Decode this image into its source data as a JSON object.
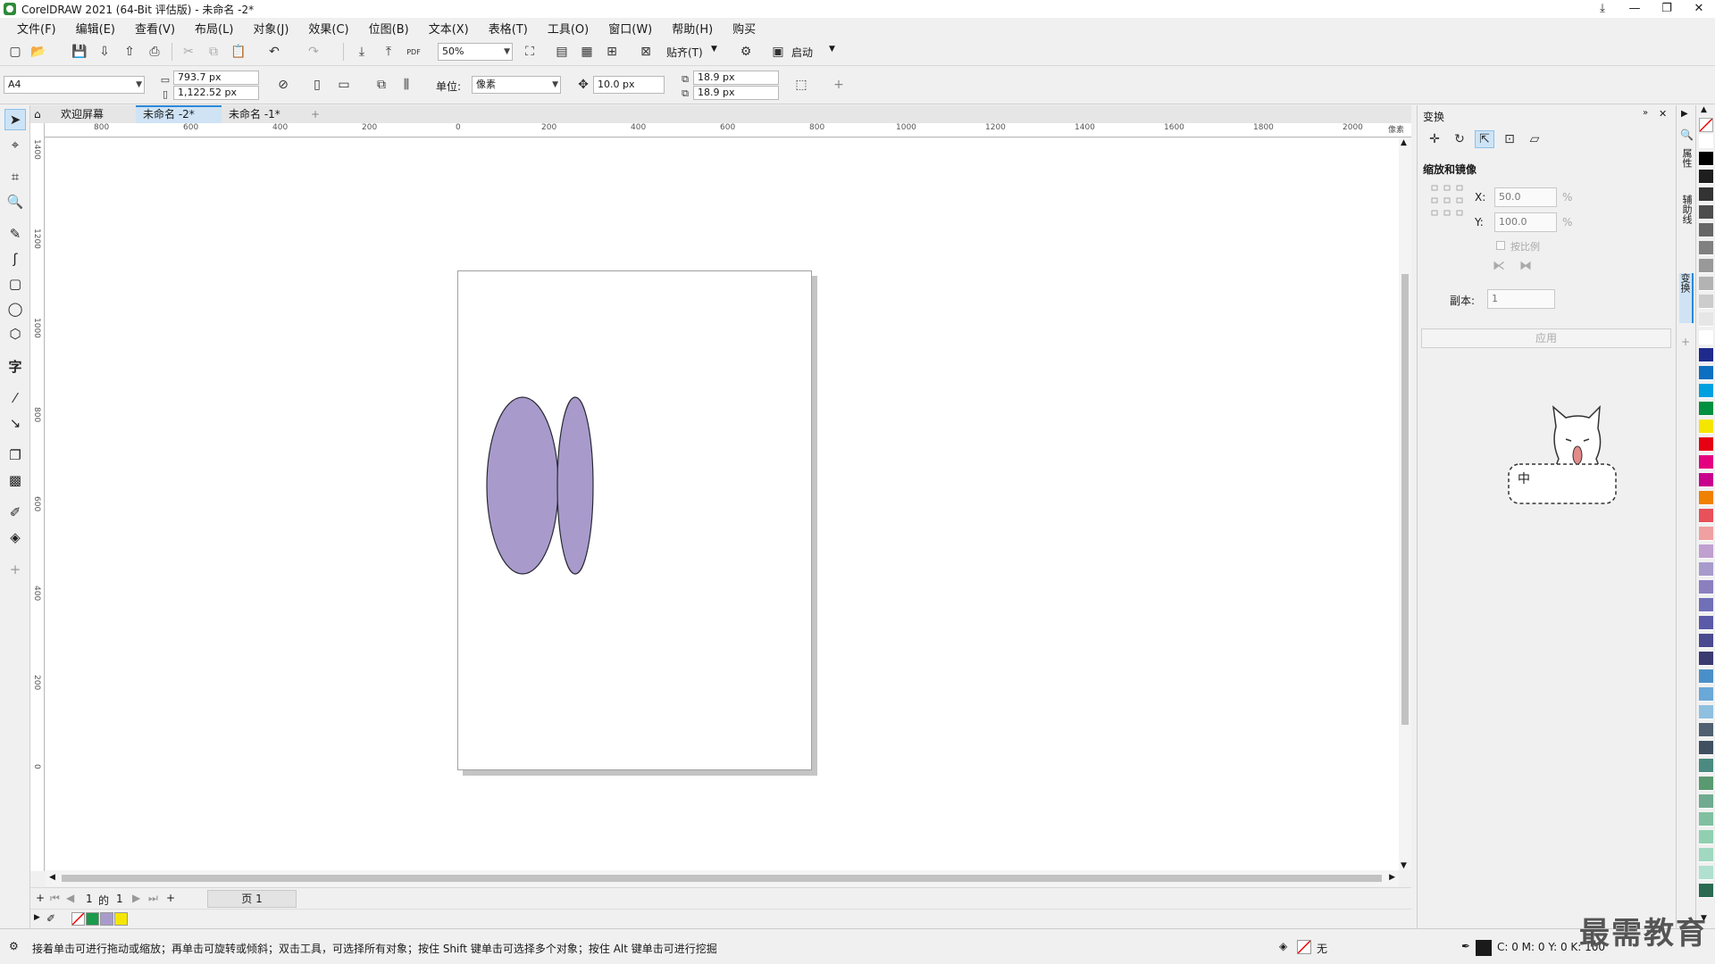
{
  "window": {
    "title": "CorelDRAW 2021 (64-Bit 评估版) - 未命名 -2*",
    "minimize": "—",
    "restore": "❐",
    "close": "✕",
    "pin": "⤓"
  },
  "menu": [
    "文件(F)",
    "编辑(E)",
    "查看(V)",
    "布局(L)",
    "对象(J)",
    "效果(C)",
    "位图(B)",
    "文本(X)",
    "表格(T)",
    "工具(O)",
    "窗口(W)",
    "帮助(H)",
    "购买"
  ],
  "toolbar": {
    "zoom": "50%",
    "snap_label": "贴齐(T)",
    "launch_label": "启动",
    "pdf_label": "PDF"
  },
  "propbar": {
    "page_size": "A4",
    "width": "793.7 px",
    "height": "1,122.52 px",
    "units_label": "单位:",
    "units_value": "像素",
    "nudge": "10.0 px",
    "dup_x": "18.9 px",
    "dup_y": "18.9 px"
  },
  "tabs": {
    "welcome": "欢迎屏幕",
    "doc2": "未命名 -2*",
    "doc1": "未命名 -1*",
    "add": "+"
  },
  "rulers": {
    "units": "像素",
    "h_labels": [
      "800",
      "600",
      "400",
      "200",
      "0",
      "200",
      "400",
      "600",
      "800",
      "1000",
      "1200",
      "1400",
      "1600",
      "1800",
      "2000"
    ],
    "v_labels": [
      "1400",
      "1200",
      "1000",
      "800",
      "600",
      "400",
      "200",
      "0"
    ]
  },
  "shapes": {
    "fill_color": "#a89bcc",
    "stroke_color": "#2a2a35"
  },
  "pagenav": {
    "current": "1",
    "of": "的",
    "total": "1",
    "page_tab": "页 1"
  },
  "docpal": {
    "colors": [
      "#1a9a4a",
      "#a89bcc",
      "#f5e600"
    ]
  },
  "status": {
    "hint": "接着单击可进行拖动或缩放；再单击可旋转或倾斜；双击工具，可选择所有对象；按住 Shift 键单击可选择多个对象；按住 Alt 键单击可进行挖掘",
    "fill_none": "无",
    "color_readout": "C: 0 M: 0 Y: 0 K: 100"
  },
  "docker": {
    "title": "变换",
    "section": "缩放和镜像",
    "x_label": "X:",
    "x_value": "50.0",
    "y_label": "Y:",
    "y_value": "100.0",
    "pct": "%",
    "proportional": "按比例",
    "copies_label": "副本:",
    "copies_value": "1",
    "apply": "应用",
    "mascot_text": "中"
  },
  "vtabs": [
    "属性",
    "辅助线",
    "变换"
  ],
  "palette": [
    "#ffffff",
    "#000000",
    "#1e1e1e",
    "#333333",
    "#4d4d4d",
    "#666666",
    "#808080",
    "#999999",
    "#b3b3b3",
    "#cccccc",
    "#e6e6e6",
    "#ffffff",
    "#1e2a8c",
    "#0e6fc0",
    "#00a0e0",
    "#009040",
    "#f5e600",
    "#e60012",
    "#e4007f",
    "#c8008c",
    "#f08000",
    "#e8505a",
    "#f0a0a0",
    "#c0a0d0",
    "#a89bcc",
    "#8c7fc0",
    "#7070b8",
    "#5a5aa8",
    "#4a4a90",
    "#3a3a70",
    "#4a90c8",
    "#6aa8d8",
    "#90c0e0",
    "#506070",
    "#405060",
    "#4a8a80",
    "#5a9a70",
    "#70aa90",
    "#80c0a0",
    "#90d0b0",
    "#a0d8c0",
    "#b0e0d0",
    "#2a6a50"
  ],
  "watermark": "最需教育"
}
